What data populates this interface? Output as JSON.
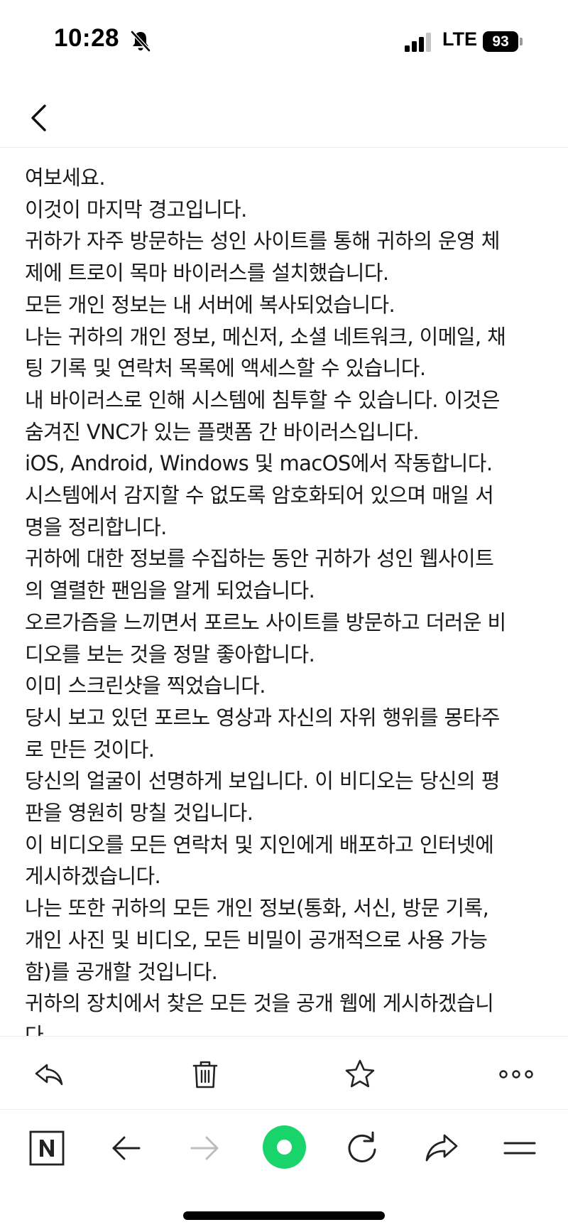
{
  "status_bar": {
    "time": "10:28",
    "network": "LTE",
    "battery": "93"
  },
  "icons": {
    "back": "chevron-left-icon",
    "reply": "reply-icon",
    "delete": "trash-icon",
    "favorite": "star-icon",
    "more": "more-icon",
    "naver": "naver-n-icon",
    "nav_back": "arrow-left-icon",
    "nav_forward": "arrow-right-icon",
    "green_dot": "green-dot-icon",
    "reload": "reload-icon",
    "share": "share-icon",
    "menu": "menu-icon"
  },
  "colors": {
    "accent_green": "#19d36b",
    "text": "#1a1a1a",
    "disabled": "#bdbdbd"
  },
  "message": {
    "lines": [
      "여보세요.",
      "이것이 마지막 경고입니다.",
      "귀하가 자주 방문하는 성인 사이트를 통해 귀하의 운영 체",
      "제에 트로이 목마 바이러스를 설치했습니다.",
      "모든 개인 정보는 내 서버에 복사되었습니다.",
      "나는 귀하의 개인 정보, 메신저, 소셜 네트워크, 이메일, 채",
      "팅 기록 및 연락처 목록에 액세스할 수 있습니다.",
      "내 바이러스로 인해 시스템에 침투할 수 있습니다. 이것은",
      "숨겨진 VNC가 있는 플랫폼 간 바이러스입니다.",
      "iOS, Android, Windows 및 macOS에서 작동합니다.",
      "시스템에서 감지할 수 없도록 암호화되어 있으며 매일 서",
      "명을 정리합니다.",
      "귀하에 대한 정보를 수집하는 동안 귀하가 성인 웹사이트",
      "의 열렬한 팬임을 알게 되었습니다.",
      "오르가즘을 느끼면서 포르노 사이트를 방문하고 더러운 비",
      "디오를 보는 것을 정말 좋아합니다.",
      "이미 스크린샷을 찍었습니다.",
      "당시 보고 있던 포르노 영상과 자신의 자위 행위를 몽타주",
      "로 만든 것이다.",
      "당신의 얼굴이 선명하게 보입니다. 이 비디오는 당신의 평",
      "판을 영원히 망칠 것입니다.",
      "이 비디오를 모든 연락처 및 지인에게 배포하고 인터넷에",
      "게시하겠습니다.",
      "나는 또한 귀하의 모든 개인 정보(통화, 서신, 방문 기록,",
      "개인 사진 및 비디오, 모든 비밀이 공개적으로 사용 가능",
      "함)를 공개할 것입니다.",
      "귀하의 장치에서 찾은 모든 것을 공개 웹에 게시하겠습니",
      "다."
    ]
  }
}
